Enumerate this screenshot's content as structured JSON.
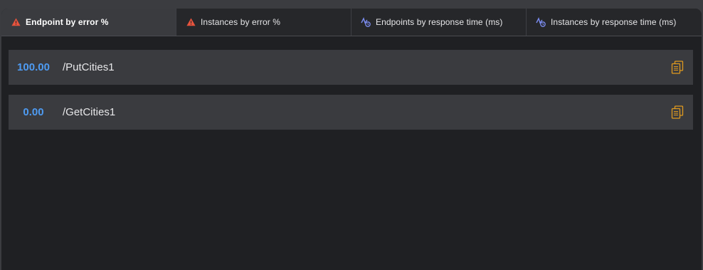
{
  "tabs": [
    {
      "label": "Endpoint by error %",
      "icon": "warning-triangle-icon",
      "active": true
    },
    {
      "label": "Instances by error %",
      "icon": "warning-triangle-icon",
      "active": false
    },
    {
      "label": "Endpoints by response time (ms)",
      "icon": "response-time-icon",
      "active": false
    },
    {
      "label": "Instances by response time (ms)",
      "icon": "response-time-icon",
      "active": false
    }
  ],
  "rows": [
    {
      "value": "100.00",
      "endpoint": "/PutCities1",
      "action_icon": "copy-icon"
    },
    {
      "value": "0.00",
      "endpoint": "/GetCities1",
      "action_icon": "copy-icon"
    }
  ],
  "colors": {
    "warning": "#e5533d",
    "response_time_icon": "#7b8cf0",
    "value": "#4e9bf2",
    "copy_icon": "#e09a1f"
  }
}
